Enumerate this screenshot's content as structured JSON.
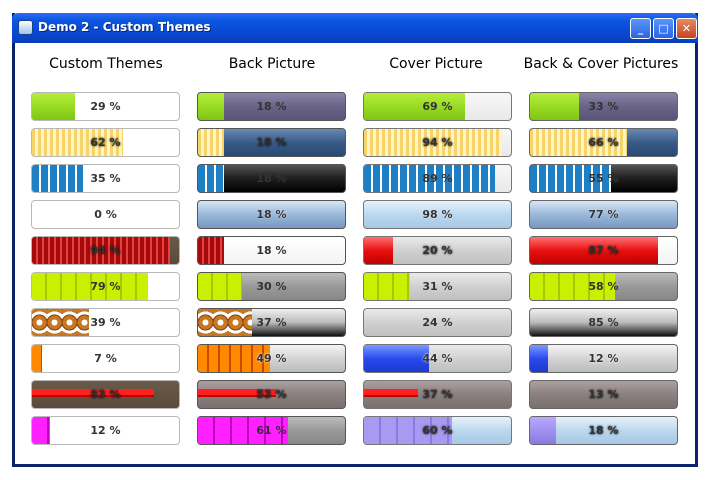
{
  "window": {
    "title": "Demo 2 - Custom Themes"
  },
  "titlebar_buttons": {
    "minimize": "_",
    "maximize": "□",
    "close": "✕"
  },
  "headers": [
    "Custom Themes",
    "Back Picture",
    "Cover Picture",
    "Back & Cover Pictures"
  ],
  "columns": [
    {
      "name": "custom-themes",
      "bars": [
        {
          "percent": 29,
          "label": "29 %"
        },
        {
          "percent": 62,
          "label": "62 %"
        },
        {
          "percent": 35,
          "label": "35 %"
        },
        {
          "percent": 0,
          "label": "0 %"
        },
        {
          "percent": 94,
          "label": "94 %"
        },
        {
          "percent": 79,
          "label": "79 %"
        },
        {
          "percent": 39,
          "label": "39 %"
        },
        {
          "percent": 7,
          "label": "7 %"
        },
        {
          "percent": 83,
          "label": "83 %"
        },
        {
          "percent": 12,
          "label": "12 %"
        }
      ]
    },
    {
      "name": "back-picture",
      "bars": [
        {
          "percent": 18,
          "label": "18 %"
        },
        {
          "percent": 18,
          "label": "18 %"
        },
        {
          "percent": 18,
          "label": "18 %"
        },
        {
          "percent": 18,
          "label": "18 %"
        },
        {
          "percent": 18,
          "label": "18 %"
        },
        {
          "percent": 30,
          "label": "30 %"
        },
        {
          "percent": 37,
          "label": "37 %"
        },
        {
          "percent": 49,
          "label": "49 %"
        },
        {
          "percent": 53,
          "label": "53 %"
        },
        {
          "percent": 61,
          "label": "61 %"
        }
      ]
    },
    {
      "name": "cover-picture",
      "bars": [
        {
          "percent": 69,
          "label": "69 %"
        },
        {
          "percent": 94,
          "label": "94 %"
        },
        {
          "percent": 89,
          "label": "89 %"
        },
        {
          "percent": 98,
          "label": "98 %"
        },
        {
          "percent": 20,
          "label": "20 %"
        },
        {
          "percent": 31,
          "label": "31 %"
        },
        {
          "percent": 24,
          "label": "24 %"
        },
        {
          "percent": 44,
          "label": "44 %"
        },
        {
          "percent": 37,
          "label": "37 %"
        },
        {
          "percent": 60,
          "label": "60 %"
        }
      ]
    },
    {
      "name": "back-and-cover-pictures",
      "bars": [
        {
          "percent": 33,
          "label": "33 %"
        },
        {
          "percent": 66,
          "label": "66 %"
        },
        {
          "percent": 55,
          "label": "55 %"
        },
        {
          "percent": 77,
          "label": "77 %"
        },
        {
          "percent": 87,
          "label": "87 %"
        },
        {
          "percent": 58,
          "label": "58 %"
        },
        {
          "percent": 85,
          "label": "85 %"
        },
        {
          "percent": 12,
          "label": "12 %"
        },
        {
          "percent": 13,
          "label": "13 %"
        },
        {
          "percent": 18,
          "label": "18 %"
        }
      ]
    }
  ]
}
